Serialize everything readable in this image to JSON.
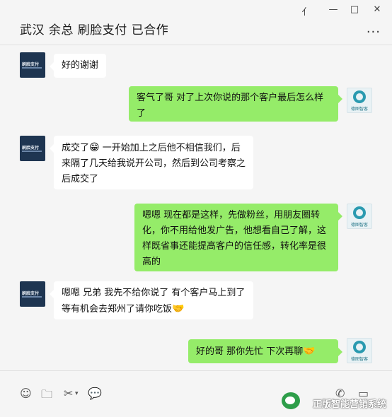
{
  "window": {
    "title": "武汉 余总  刷脸支付 已合作",
    "controls": {
      "pin": "⺅",
      "minimize": "—",
      "maximize": "□",
      "close": "✕"
    },
    "more": "..."
  },
  "avatars": {
    "contact_label": "刷脸支付",
    "self_label": "德图智客"
  },
  "messages": [
    {
      "side": "in",
      "text": "好的谢谢"
    },
    {
      "side": "out",
      "text": "客气了哥  对了上次你说的那个客户最后怎么样了"
    },
    {
      "side": "in",
      "text_before": "成交了",
      "emoji": "😁",
      "text_after": " 一开始加上之后他不相信我们，后来隔了几天给我说开公司，然后到公司考察之后成交了"
    },
    {
      "side": "out",
      "text": "嗯嗯 现在都是这样，先做粉丝，用朋友圈转化，你不用给他发广告，他想看自己了解，这样既省事还能提高客户的信任感，转化率是很高的"
    },
    {
      "side": "in",
      "text_before": "嗯嗯  兄弟  我先不给你说了 有个客户马上到了  等有机会去郑州了请你吃饭",
      "emoji": "🤝"
    },
    {
      "side": "out",
      "text_before": "好的哥 那你先忙  下次再聊",
      "emoji": "🤝"
    }
  ],
  "toolbar": {
    "emoji_icon": "☺",
    "folder_icon": "🗀",
    "scissors_icon": "✂",
    "chat_icon": "💬",
    "phone_icon": "✆",
    "video_icon": "▭"
  },
  "watermark": {
    "text": "正版智能营销系统"
  }
}
